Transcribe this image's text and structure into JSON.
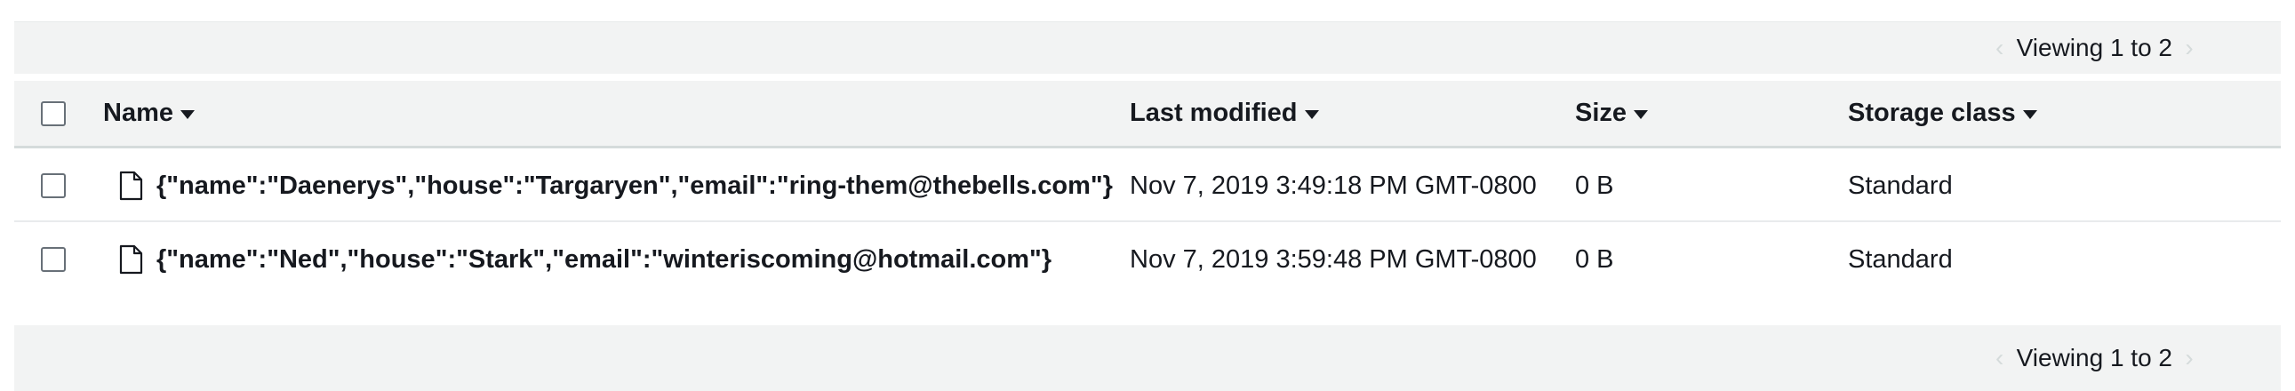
{
  "pagination": {
    "top_text": "Viewing 1 to 2",
    "bottom_text": "Viewing 1 to 2",
    "prev_icon": "chevron-left-icon",
    "next_icon": "chevron-right-icon"
  },
  "table": {
    "columns": {
      "name": "Name",
      "last_modified": "Last modified",
      "size": "Size",
      "storage_class": "Storage class"
    },
    "rows": [
      {
        "name": "{\"name\":\"Daenerys\",\"house\":\"Targaryen\",\"email\":\"ring-them@thebells.com\"}",
        "last_modified": "Nov 7, 2019 3:49:18 PM GMT-0800",
        "size": "0 B",
        "storage_class": "Standard",
        "icon": "file-icon"
      },
      {
        "name": "{\"name\":\"Ned\",\"house\":\"Stark\",\"email\":\"winteriscoming@hotmail.com\"}",
        "last_modified": "Nov 7, 2019 3:59:48 PM GMT-0800",
        "size": "0 B",
        "storage_class": "Standard",
        "icon": "file-icon"
      }
    ]
  },
  "colors": {
    "header_bg": "#f2f3f3",
    "text": "#16191f",
    "border": "#d5dbdb",
    "disabled_arrow": "#d5dbdb"
  }
}
